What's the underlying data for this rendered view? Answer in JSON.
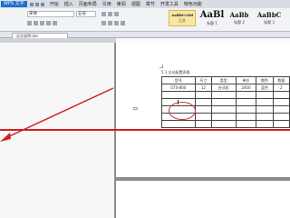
{
  "app": {
    "menu_label": "WPS 文字",
    "menu_items": [
      "开始",
      "插入",
      "页面布局",
      "引用",
      "审阅",
      "视图",
      "章节",
      "开发工具",
      "特色功能"
    ]
  },
  "ribbon": {
    "font_name": "宋体",
    "font_size": "五号",
    "styles": [
      {
        "sample": "AaBbCcDd",
        "name": "正文"
      },
      {
        "sample": "AaBl",
        "name": "标题 1"
      },
      {
        "sample": "AaBb",
        "name": "标题 2"
      },
      {
        "sample": "AaBbC",
        "name": "标题 3"
      }
    ]
  },
  "tabs": {
    "document_label": "论文说明.doc"
  },
  "document": {
    "caption": "5.1 全站配置表格",
    "table": {
      "header": [
        "型号",
        "尺寸",
        "类型",
        "单价",
        "颜色",
        "数量"
      ],
      "rows": [
        [
          "GTX-800",
          "12",
          "台式机",
          "2000",
          "蓝色",
          "2"
        ],
        [
          "",
          "",
          "",
          "",
          "",
          ""
        ],
        [
          "",
          "",
          "",
          "",
          "",
          ""
        ],
        [
          "",
          "",
          "",
          "",
          "",
          ""
        ],
        [
          "",
          "",
          "",
          "",
          "",
          ""
        ],
        [
          "",
          "",
          "",
          "",
          "",
          ""
        ]
      ]
    }
  },
  "annotations": {
    "arrow_color": "#d21f1f",
    "line_color": "#d21f1f",
    "circle_color": "#c0392b"
  }
}
